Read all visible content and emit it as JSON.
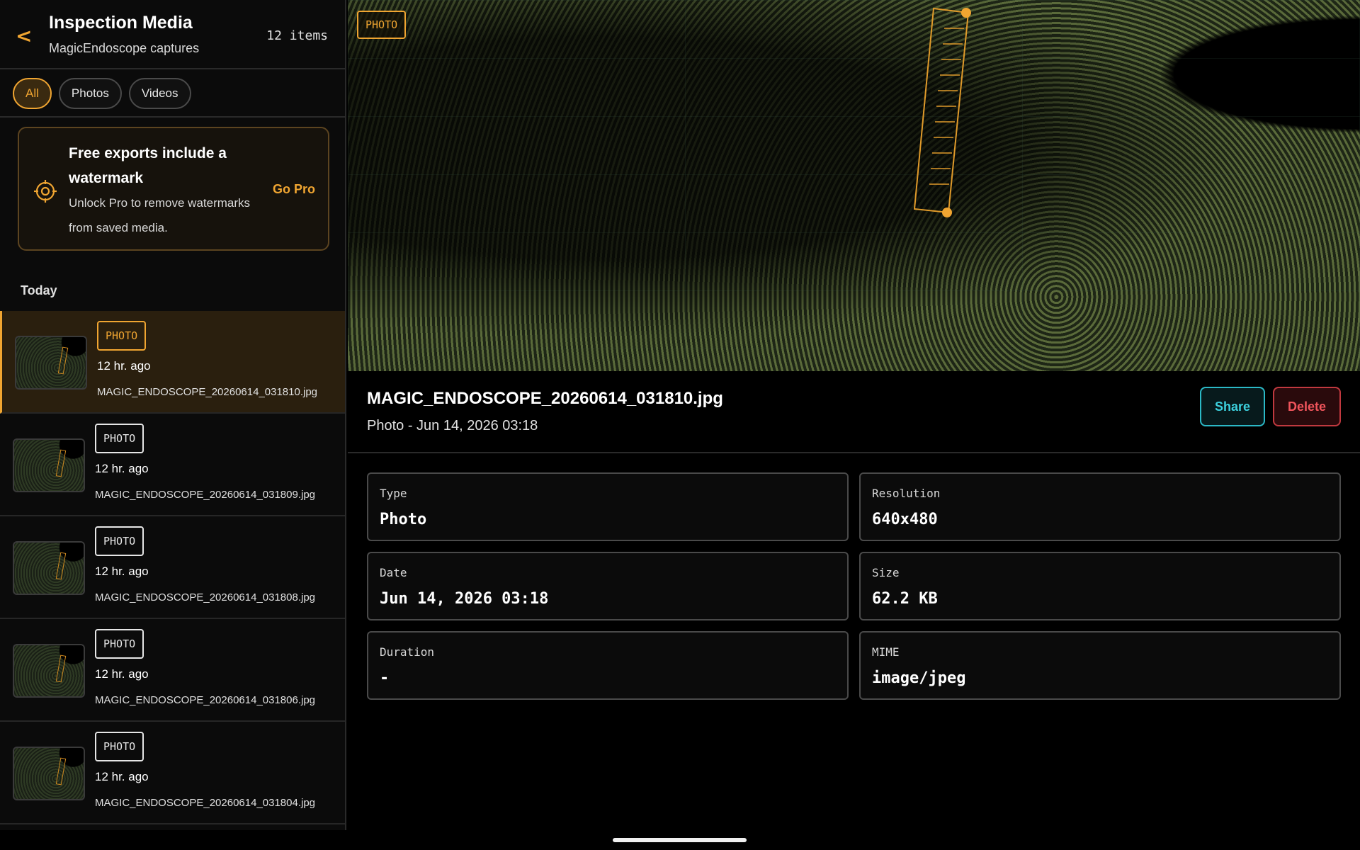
{
  "header": {
    "back_label": "<",
    "title": "Inspection Media",
    "subtitle": "MagicEndoscope captures",
    "count": "12 items"
  },
  "filters": [
    {
      "label": "All",
      "active": true
    },
    {
      "label": "Photos",
      "active": false
    },
    {
      "label": "Videos",
      "active": false
    }
  ],
  "promo": {
    "icon": "crosshair-icon",
    "title": "Free exports include a watermark",
    "body": "Unlock Pro to remove watermarks from saved media.",
    "cta": "Go Pro"
  },
  "section_label": "Today",
  "media_items": [
    {
      "badge": "PHOTO",
      "time": "12 hr. ago",
      "name": "MAGIC_ENDOSCOPE_20260614_031810.jpg",
      "selected": true
    },
    {
      "badge": "PHOTO",
      "time": "12 hr. ago",
      "name": "MAGIC_ENDOSCOPE_20260614_031809.jpg",
      "selected": false
    },
    {
      "badge": "PHOTO",
      "time": "12 hr. ago",
      "name": "MAGIC_ENDOSCOPE_20260614_031808.jpg",
      "selected": false
    },
    {
      "badge": "PHOTO",
      "time": "12 hr. ago",
      "name": "MAGIC_ENDOSCOPE_20260614_031806.jpg",
      "selected": false
    },
    {
      "badge": "PHOTO",
      "time": "12 hr. ago",
      "name": "MAGIC_ENDOSCOPE_20260614_031804.jpg",
      "selected": false
    }
  ],
  "preview": {
    "badge": "PHOTO"
  },
  "detail": {
    "file_name": "MAGIC_ENDOSCOPE_20260614_031810.jpg",
    "meta": "Photo - Jun 14, 2026 03:18",
    "share_label": "Share",
    "delete_label": "Delete",
    "info": [
      {
        "label": "Type",
        "value": "Photo"
      },
      {
        "label": "Resolution",
        "value": "640x480"
      },
      {
        "label": "Date",
        "value": "Jun 14, 2026 03:18"
      },
      {
        "label": "Size",
        "value": "62.2 KB"
      },
      {
        "label": "Duration",
        "value": "-"
      },
      {
        "label": "MIME",
        "value": "image/jpeg"
      }
    ]
  },
  "colors": {
    "accent": "#f0a531",
    "share": "#3ccfdc",
    "delete": "#f0545b",
    "background": "#000000"
  }
}
